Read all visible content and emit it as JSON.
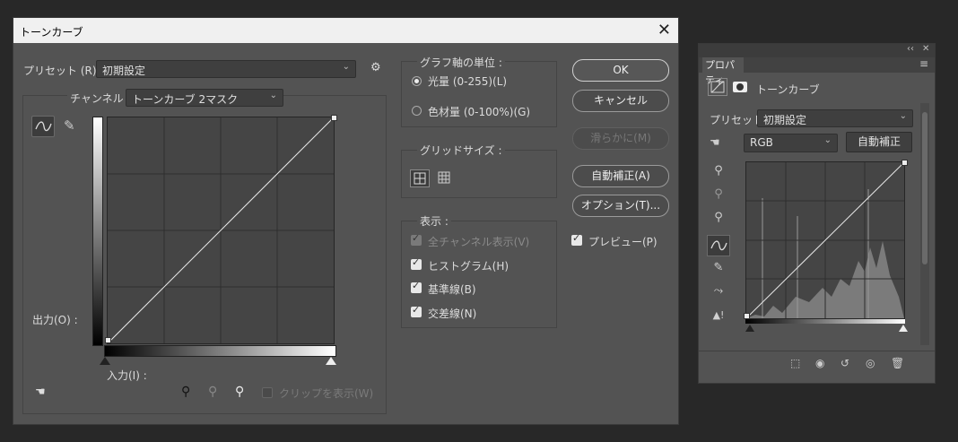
{
  "dialog": {
    "title": "トーンカーブ",
    "close_glyph": "✕",
    "preset_label": "プリセット (R) :",
    "preset_value": "初期設定",
    "channel_label": "チャンネル :",
    "channel_value": "トーンカーブ 2マスク",
    "output_label": "出力(O) :",
    "input_label": "入力(I) :",
    "show_clipping": "クリップを表示(W)",
    "curve_display": {
      "title": "グラフ軸の単位 :",
      "light": "光量 (0-255)(L)",
      "pigment": "色材量 (0-100%)(G)"
    },
    "grid_size": {
      "title": "グリッドサイズ :"
    },
    "show": {
      "title": "表示 :",
      "channel_overlays": "全チャンネル表示(V)",
      "histogram": "ヒストグラム(H)",
      "baseline": "基準線(B)",
      "intersection": "交差線(N)"
    },
    "buttons": {
      "ok": "OK",
      "cancel": "キャンセル",
      "smooth": "滑らかに(M)",
      "auto": "自動補正(A)",
      "options": "オプション(T)..."
    },
    "preview": "プレビュー(P)"
  },
  "properties": {
    "tab": "プロパティ",
    "adjustment_name": "トーンカーブ",
    "preset_label": "プリセット :",
    "preset_value": "初期設定",
    "channel_value": "RGB",
    "auto_button": "自動補正",
    "menu_glyph": "≡",
    "collapse_glyph": "‹‹",
    "close_glyph": "✕"
  },
  "colors": {
    "dialog_bg": "#535353",
    "titlebar_bg": "#f0f0f0",
    "graph_bg": "#454545",
    "histogram": "#7b7b7b"
  }
}
